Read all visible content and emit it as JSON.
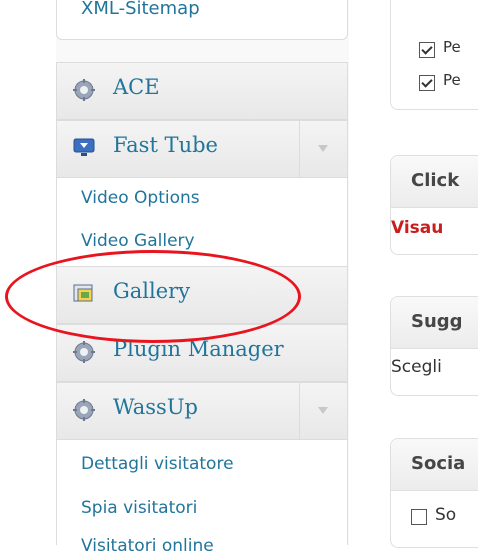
{
  "sidebar": {
    "top_submenu_link": "XML-Sitemap",
    "menu": [
      {
        "label": "ACE",
        "icon": "gear-icon",
        "has_toggle": false
      },
      {
        "label": "Fast Tube",
        "icon": "monitor-download-icon",
        "has_toggle": true,
        "submenu": [
          "Video Options",
          "Video Gallery"
        ]
      },
      {
        "label": "Gallery",
        "icon": "gallery-icon",
        "has_toggle": false,
        "highlighted": true
      },
      {
        "label": "Plugin Manager",
        "icon": "gear-icon",
        "has_toggle": false
      },
      {
        "label": "WassUp",
        "icon": "gear-icon",
        "has_toggle": true,
        "submenu": [
          "Dettagli visitatore",
          "Spia visitatori",
          "Visitatori online"
        ]
      }
    ]
  },
  "right": {
    "top_box": {
      "checkbox1_label": "Pe",
      "checkbox2_label": "Pe",
      "checkbox1_checked": true,
      "checkbox2_checked": true
    },
    "click_box": {
      "title": "Click",
      "link": "Visau"
    },
    "sugg_box": {
      "title": "Sugg",
      "text": "Scegli"
    },
    "social_box": {
      "title": "Socia",
      "checkbox_label": "So",
      "checkbox_checked": false
    }
  },
  "colors": {
    "link": "#21759b",
    "highlight_ellipse": "#e8141e",
    "red_link": "#c81e1e"
  }
}
